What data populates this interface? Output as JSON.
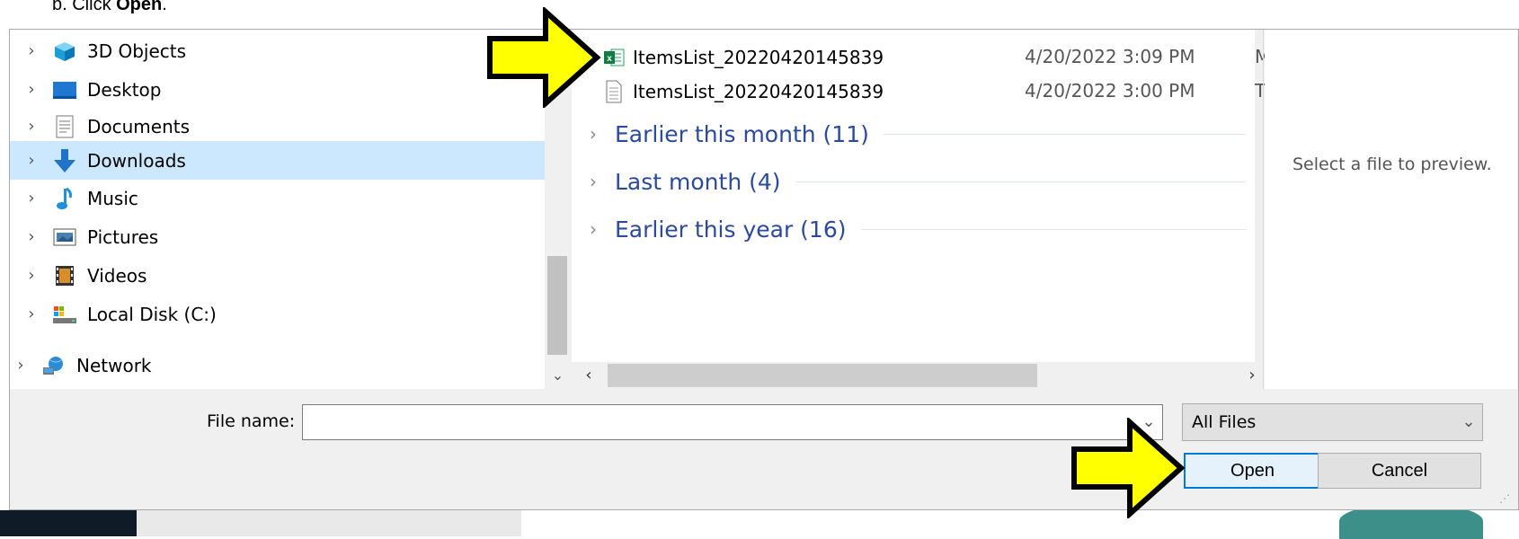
{
  "instruction": {
    "prefix": "b.   Click ",
    "bold": "Open",
    "suffix": "."
  },
  "nav": {
    "items": [
      {
        "label": "3D Objects",
        "icon": "3d-objects-icon"
      },
      {
        "label": "Desktop",
        "icon": "desktop-icon"
      },
      {
        "label": "Documents",
        "icon": "documents-icon"
      },
      {
        "label": "Downloads",
        "icon": "downloads-icon",
        "selected": true
      },
      {
        "label": "Music",
        "icon": "music-icon"
      },
      {
        "label": "Pictures",
        "icon": "pictures-icon"
      },
      {
        "label": "Videos",
        "icon": "videos-icon"
      },
      {
        "label": "Local Disk (C:)",
        "icon": "local-disk-icon"
      },
      {
        "label": "Network",
        "icon": "network-icon"
      }
    ]
  },
  "files": {
    "rows": [
      {
        "name": "ItemsList_20220420145839",
        "date": "4/20/2022 3:09 PM",
        "type_initial": "M",
        "icon": "excel-icon"
      },
      {
        "name": "ItemsList_20220420145839",
        "date": "4/20/2022 3:00 PM",
        "type_initial": "T",
        "icon": "text-file-icon"
      }
    ],
    "groups": [
      {
        "label": "Earlier this month (11)"
      },
      {
        "label": "Last month (4)"
      },
      {
        "label": "Earlier this year (16)"
      }
    ]
  },
  "preview": {
    "text": "Select a file to preview."
  },
  "bottom": {
    "file_name_label": "File name:",
    "file_name_value": "",
    "filter_value": "All Files",
    "open_label": "Open",
    "cancel_label": "Cancel"
  },
  "colors": {
    "callout": "#ffff00",
    "selection": "#cce8ff",
    "group_text": "#2b4a9e",
    "accent": "#0078d7"
  }
}
